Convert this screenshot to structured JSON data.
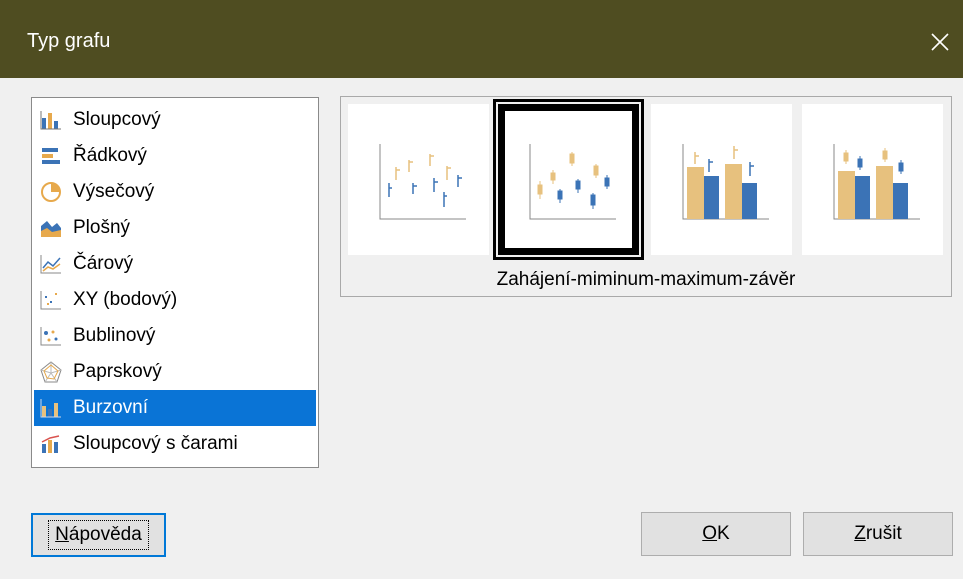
{
  "window": {
    "title": "Typ grafu"
  },
  "chart_types": [
    {
      "label": "Sloupcový",
      "icon": "column-chart-icon"
    },
    {
      "label": "Řádkový",
      "icon": "bar-chart-icon"
    },
    {
      "label": "Výsečový",
      "icon": "pie-chart-icon"
    },
    {
      "label": "Plošný",
      "icon": "area-chart-icon"
    },
    {
      "label": "Čárový",
      "icon": "line-chart-icon"
    },
    {
      "label": "XY (bodový)",
      "icon": "xy-scatter-icon"
    },
    {
      "label": "Bublinový",
      "icon": "bubble-chart-icon"
    },
    {
      "label": "Paprskový",
      "icon": "net-chart-icon"
    },
    {
      "label": "Burzovní",
      "icon": "stock-chart-icon",
      "selected": true
    },
    {
      "label": "Sloupcový s čarami",
      "icon": "column-line-chart-icon"
    }
  ],
  "variants": {
    "items": [
      "stock-variant-1",
      "stock-variant-2",
      "stock-variant-3",
      "stock-variant-4"
    ],
    "selected_index": 1,
    "caption": "Zahájení-miminum-maximum-závěr"
  },
  "buttons": {
    "help": {
      "label": "Nápověda",
      "mnemonic": "N",
      "rest": "ápověda"
    },
    "ok": {
      "label": "OK",
      "mnemonic": "O",
      "rest": "K"
    },
    "cancel": {
      "label": "Zrušit",
      "mnemonic": "Z",
      "rest": "rušit"
    }
  },
  "colors": {
    "titlebar": "#4f4d21",
    "selection": "#0a74d6",
    "tan": "#e7c17e",
    "blue": "#3b73b6"
  }
}
